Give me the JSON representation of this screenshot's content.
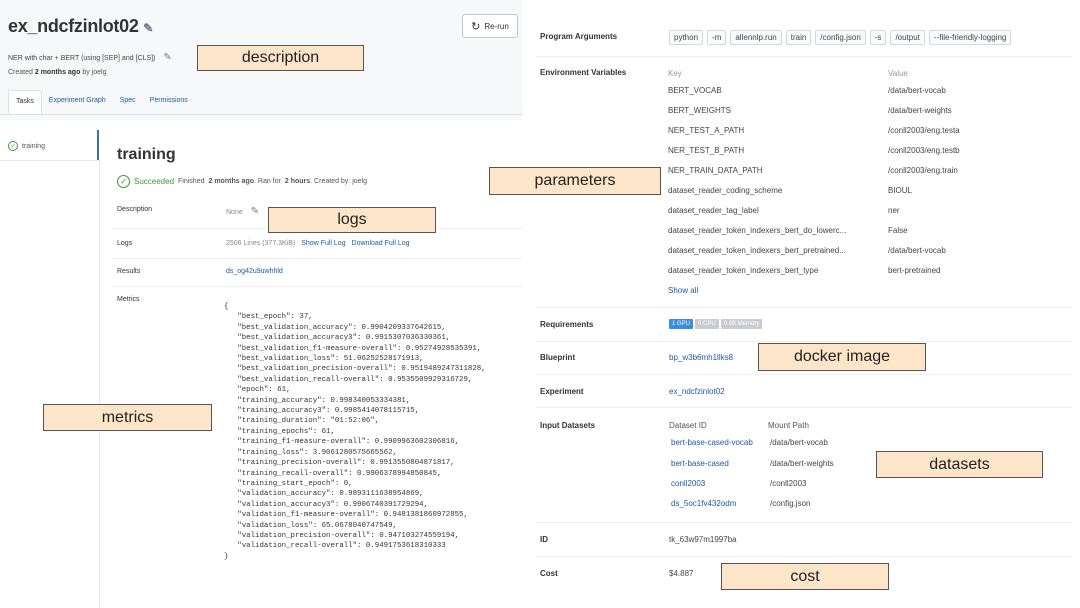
{
  "header": {
    "title": "ex_ndcfzinlot02",
    "rerun_label": "Re-run",
    "description": "NER with char + BERT (using [SEP] and [CLS])",
    "created_prefix": "Created",
    "created_time": "2 months ago",
    "created_suffix": "by joelg"
  },
  "tabs": [
    "Tasks",
    "Experiment Graph",
    "Spec",
    "Permissions"
  ],
  "tasks": [
    {
      "label": "training"
    }
  ],
  "task": {
    "title": "training",
    "status": "Succeeded",
    "finished_prefix": "Finished",
    "finished_time": "2 months ago",
    "ran_for_prefix": ". Ran for",
    "ran_for": "2 hours",
    "created_by": ". Created by: joelg",
    "rows": {
      "description_label": "Description",
      "description_value": "None",
      "logs_label": "Logs",
      "logs_value": "2506 Lines (377.3KiB)",
      "logs_show_full": "Show Full Log",
      "logs_download": "Download Full Log",
      "results_label": "Results",
      "results_value": "ds_og42u9uwhhld",
      "metrics_label": "Metrics"
    },
    "metrics_json": "{\n   \"best_epoch\": 37,\n   \"best_validation_accuracy\": 0.9904209337642615,\n   \"best_validation_accuracy3\": 0.9915307036330361,\n   \"best_validation_f1-measure-overall\": 0.95274928535391,\n   \"best_validation_loss\": 51.06252528171913,\n   \"best_validation_precision-overall\": 0.9519489247311828,\n   \"best_validation_recall-overall\": 0.9535509929316729,\n   \"epoch\": 61,\n   \"training_accuracy\": 0.998340053334381,\n   \"training_accuracy3\": 0.9985414078115715,\n   \"training_duration\": \"01:52:06\",\n   \"training_epochs\": 61,\n   \"training_f1-measure-overall\": 0.9909963602306816,\n   \"training_loss\": 3.9061280575665562,\n   \"training_precision-overall\": 0.9913550804871817,\n   \"training_recall-overall\": 0.9906378994850845,\n   \"training_start_epoch\": 0,\n   \"validation_accuracy\": 0.9893111638954869,\n   \"validation_accuracy3\": 0.9906740391729294,\n   \"validation_f1-measure-overall\": 0.9481381860972855,\n   \"validation_loss\": 65.0678040747549,\n   \"validation_precision-overall\": 0.947103274559194,\n   \"validation_recall-overall\": 0.9491753618310333\n}"
  },
  "annotations": {
    "description": "description",
    "logs": "logs",
    "metrics": "metrics",
    "parameters": "parameters",
    "docker_image": "docker image",
    "datasets": "datasets",
    "cost": "cost"
  },
  "right": {
    "program_args_label": "Program Arguments",
    "program_args": [
      "python",
      "-m",
      "allennlp.run",
      "train",
      "/config.json",
      "-s",
      "/output",
      "--file-friendly-logging"
    ],
    "env_label": "Environment Variables",
    "env_key_header": "Key",
    "env_value_header": "Value",
    "env": [
      {
        "key": "BERT_VOCAB",
        "value": "/data/bert-vocab"
      },
      {
        "key": "BERT_WEIGHTS",
        "value": "/data/bert-weights"
      },
      {
        "key": "NER_TEST_A_PATH",
        "value": "/conll2003/eng.testa"
      },
      {
        "key": "NER_TEST_B_PATH",
        "value": "/conll2003/eng.testb"
      },
      {
        "key": "NER_TRAIN_DATA_PATH",
        "value": "/conll2003/eng.train"
      },
      {
        "key": "dataset_reader_coding_scheme",
        "value": "BIOUL"
      },
      {
        "key": "dataset_reader_tag_label",
        "value": "ner"
      },
      {
        "key": "dataset_reader_token_indexers_bert_do_lowerc...",
        "value": "False"
      },
      {
        "key": "dataset_reader_token_indexers_bert_pretrained...",
        "value": "/data/bert-vocab"
      },
      {
        "key": "dataset_reader_token_indexers_bert_type",
        "value": "bert-pretrained"
      }
    ],
    "show_all": "Show all",
    "requirements_label": "Requirements",
    "requirements": [
      "1 GPU",
      "0 CPU",
      "0.0B Memory"
    ],
    "blueprint_label": "Blueprint",
    "blueprint_value": "bp_w3b6mh1llks8",
    "experiment_label": "Experiment",
    "experiment_value": "ex_ndcfzinlot02",
    "input_datasets_label": "Input Datasets",
    "dataset_id_header": "Dataset ID",
    "mount_path_header": "Mount Path",
    "datasets": [
      {
        "id": "bert-base-cased-vocab",
        "path": "/data/bert-vocab"
      },
      {
        "id": "bert-base-cased",
        "path": "/data/bert-weights"
      },
      {
        "id": "conll2003",
        "path": "/conll2003"
      },
      {
        "id": "ds_5oc1fv432odm",
        "path": "/config.json"
      }
    ],
    "id_label": "ID",
    "id_value": "tk_63w97m1997ba",
    "cost_label": "Cost",
    "cost_value": "$4.887"
  },
  "colors": {
    "link": "#1d5aa6",
    "success": "#3a9a3a",
    "annotation_fill": "#fce5c8",
    "gpu_badge": "#3c8dde"
  }
}
